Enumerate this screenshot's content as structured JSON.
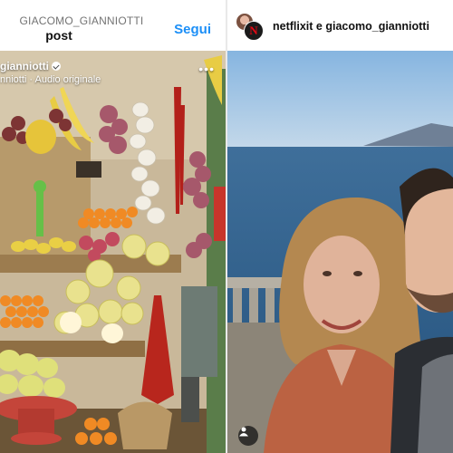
{
  "left_post": {
    "header_username": "GIACOMO_GIANNIOTTI",
    "header_title": "post",
    "follow_label": "Segui",
    "overlay_username": "gianniotti",
    "overlay_audio": "nniotti · Audio originale",
    "more_icon": "more-dots-icon"
  },
  "right_post": {
    "title": "netflixit e giacomo_gianniotti",
    "netflix_logo_letter": "N",
    "tag_icon": "person-tag-icon"
  },
  "colors": {
    "follow_blue": "#1c8ff7",
    "netflix_red": "#e50914"
  }
}
